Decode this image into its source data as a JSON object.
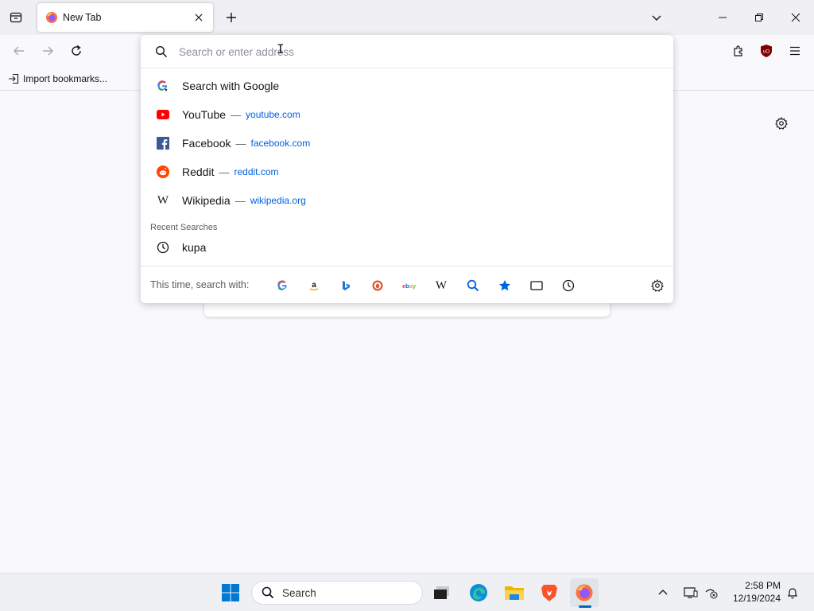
{
  "tab": {
    "title": "New Tab"
  },
  "bookmarks": {
    "import_label": "Import bookmarks..."
  },
  "urlbar": {
    "placeholder": "Search or enter address",
    "suggestions": [
      {
        "title": "Search with Google",
        "sep": "",
        "url": ""
      },
      {
        "title": "YouTube",
        "sep": "—",
        "url": "youtube.com"
      },
      {
        "title": "Facebook",
        "sep": "—",
        "url": "facebook.com"
      },
      {
        "title": "Reddit",
        "sep": "—",
        "url": "reddit.com"
      },
      {
        "title": "Wikipedia",
        "sep": "—",
        "url": "wikipedia.org"
      }
    ],
    "recent_label": "Recent Searches",
    "recent": [
      {
        "title": "kupa"
      }
    ],
    "oneoff_label": "This time, search with:",
    "oneoff_engines": [
      "google-icon",
      "amazon-icon",
      "bing-icon",
      "duckduckgo-icon",
      "ebay-icon",
      "wikipedia-icon",
      "search-icon",
      "bookmarks-star-icon",
      "tabs-icon",
      "history-clock-icon"
    ]
  },
  "taskbar": {
    "search_label": "Search",
    "time": "2:58 PM",
    "date": "12/19/2024"
  },
  "colors": {
    "accent": "#0061e0",
    "ublock": "#800000",
    "windows_blue": "#0067c0"
  }
}
